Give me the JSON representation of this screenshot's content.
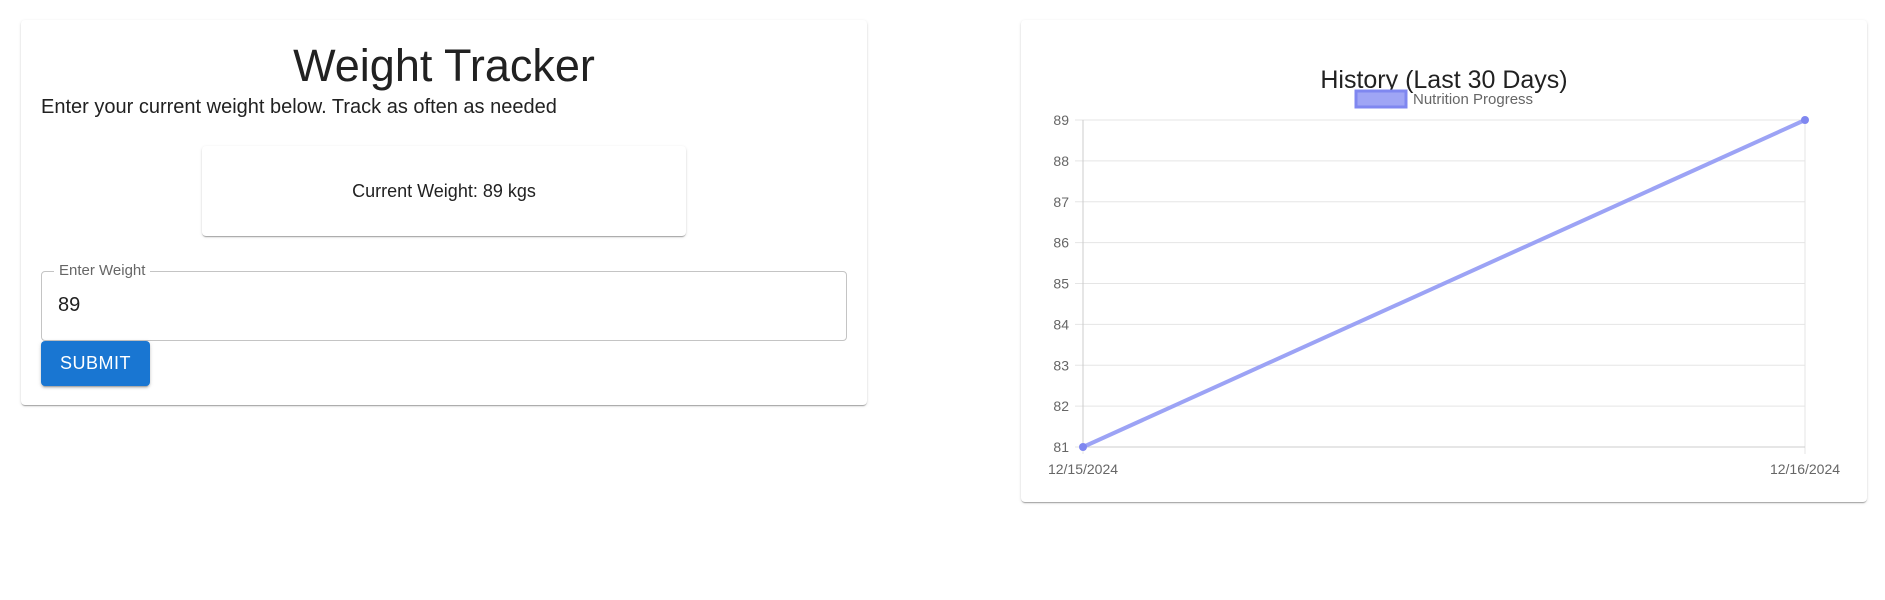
{
  "tracker": {
    "title": "Weight Tracker",
    "subtitle": "Enter your current weight below. Track as often as needed",
    "current_weight_text": "Current Weight: 89 kgs",
    "input_label": "Enter Weight",
    "input_value": "89",
    "submit_label": "SUBMIT"
  },
  "colors": {
    "primary_button": "#1976d2",
    "series_line": "#9ca3f5",
    "series_fill": "#9fa5f5"
  },
  "chart_data": {
    "type": "line",
    "title": "History (Last 30 Days)",
    "x": [
      "12/15/2024",
      "12/16/2024"
    ],
    "series": [
      {
        "name": "Nutrition Progress",
        "values": [
          81,
          89
        ]
      }
    ],
    "ylim": [
      81,
      89
    ],
    "yticks": [
      81,
      82,
      83,
      84,
      85,
      86,
      87,
      88,
      89
    ],
    "grid": true,
    "legend": "top-center"
  }
}
